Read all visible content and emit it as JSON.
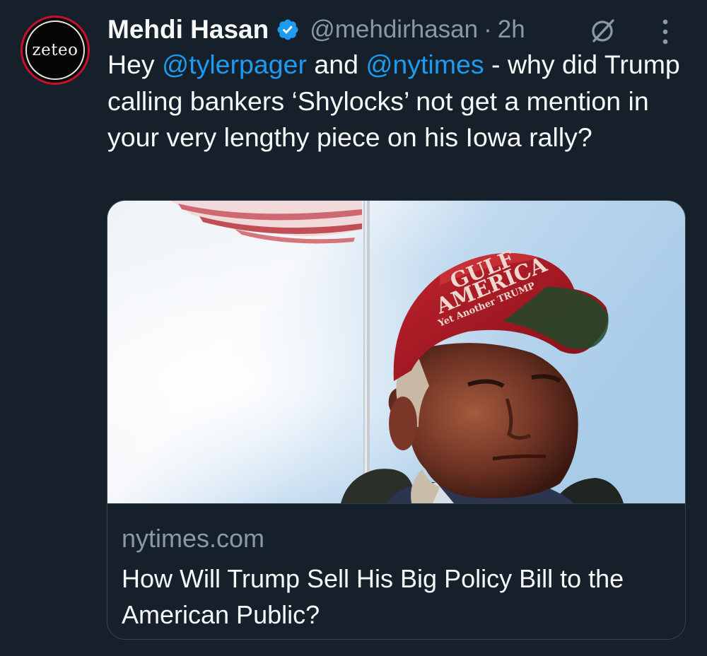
{
  "author": {
    "avatar_text": "zeteo",
    "name": "Mehdi Hasan",
    "handle": "@mehdirhasan",
    "separator": "·",
    "time": "2h"
  },
  "icons": {
    "verified": "verified-badge-icon",
    "grok": "grok-icon",
    "more": "more-options-icon"
  },
  "tweet": {
    "segments": [
      {
        "text": "Hey ",
        "type": "text"
      },
      {
        "text": "@tylerpager",
        "type": "mention"
      },
      {
        "text": " and ",
        "type": "text"
      },
      {
        "text": "@nytimes",
        "type": "mention"
      },
      {
        "text": " - why did Trump calling bankers ‘Shylocks’ not get a mention in your very lengthy piece on his Iowa rally?",
        "type": "text"
      }
    ]
  },
  "card": {
    "image_hat_text_line1": "GULF",
    "image_hat_text_line2": "AMERICA",
    "image_hat_text_line3": "Yet Another TRUMP",
    "domain": "nytimes.com",
    "headline": "How Will Trump Sell His Big Policy Bill to the American Public?"
  },
  "colors": {
    "background": "#15202b",
    "text": "#f7f9f9",
    "secondary": "#8b98a5",
    "accent": "#1d9bf0",
    "border": "#38444d"
  }
}
